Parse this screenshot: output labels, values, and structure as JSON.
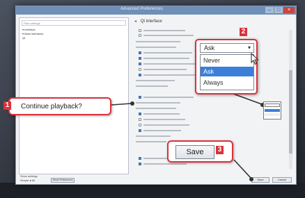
{
  "window": {
    "title": "Advanced Preferences",
    "buttons": [
      "–",
      "□",
      "×"
    ]
  },
  "left_panel": {
    "search_placeholder": "Filter settings",
    "tree": [
      "▾ Interface",
      "   ▾ Main interfaces",
      "      Qt"
    ]
  },
  "right_panel": {
    "header": "Qt interface",
    "header_arrow": "◂"
  },
  "bottom": {
    "show_settings_label": "Show settings",
    "mode_label": "Simple  ● All",
    "reset_label": "Reset Preferences",
    "cancel_label": "Cancel",
    "save_small_label": "Save"
  },
  "callouts": {
    "continue": {
      "number": "1",
      "text": "Continue playback?"
    },
    "dropdown": {
      "number": "2"
    },
    "save": {
      "number": "3",
      "button_label": "Save"
    }
  },
  "dropdown": {
    "selected": "Ask",
    "arrow": "▾",
    "options": [
      {
        "label": "Never",
        "selected": false
      },
      {
        "label": "Ask",
        "selected": true
      },
      {
        "label": "Always",
        "selected": false
      }
    ]
  },
  "colors": {
    "callout_red": "#d8323c",
    "selection_blue": "#3b7fd9"
  }
}
